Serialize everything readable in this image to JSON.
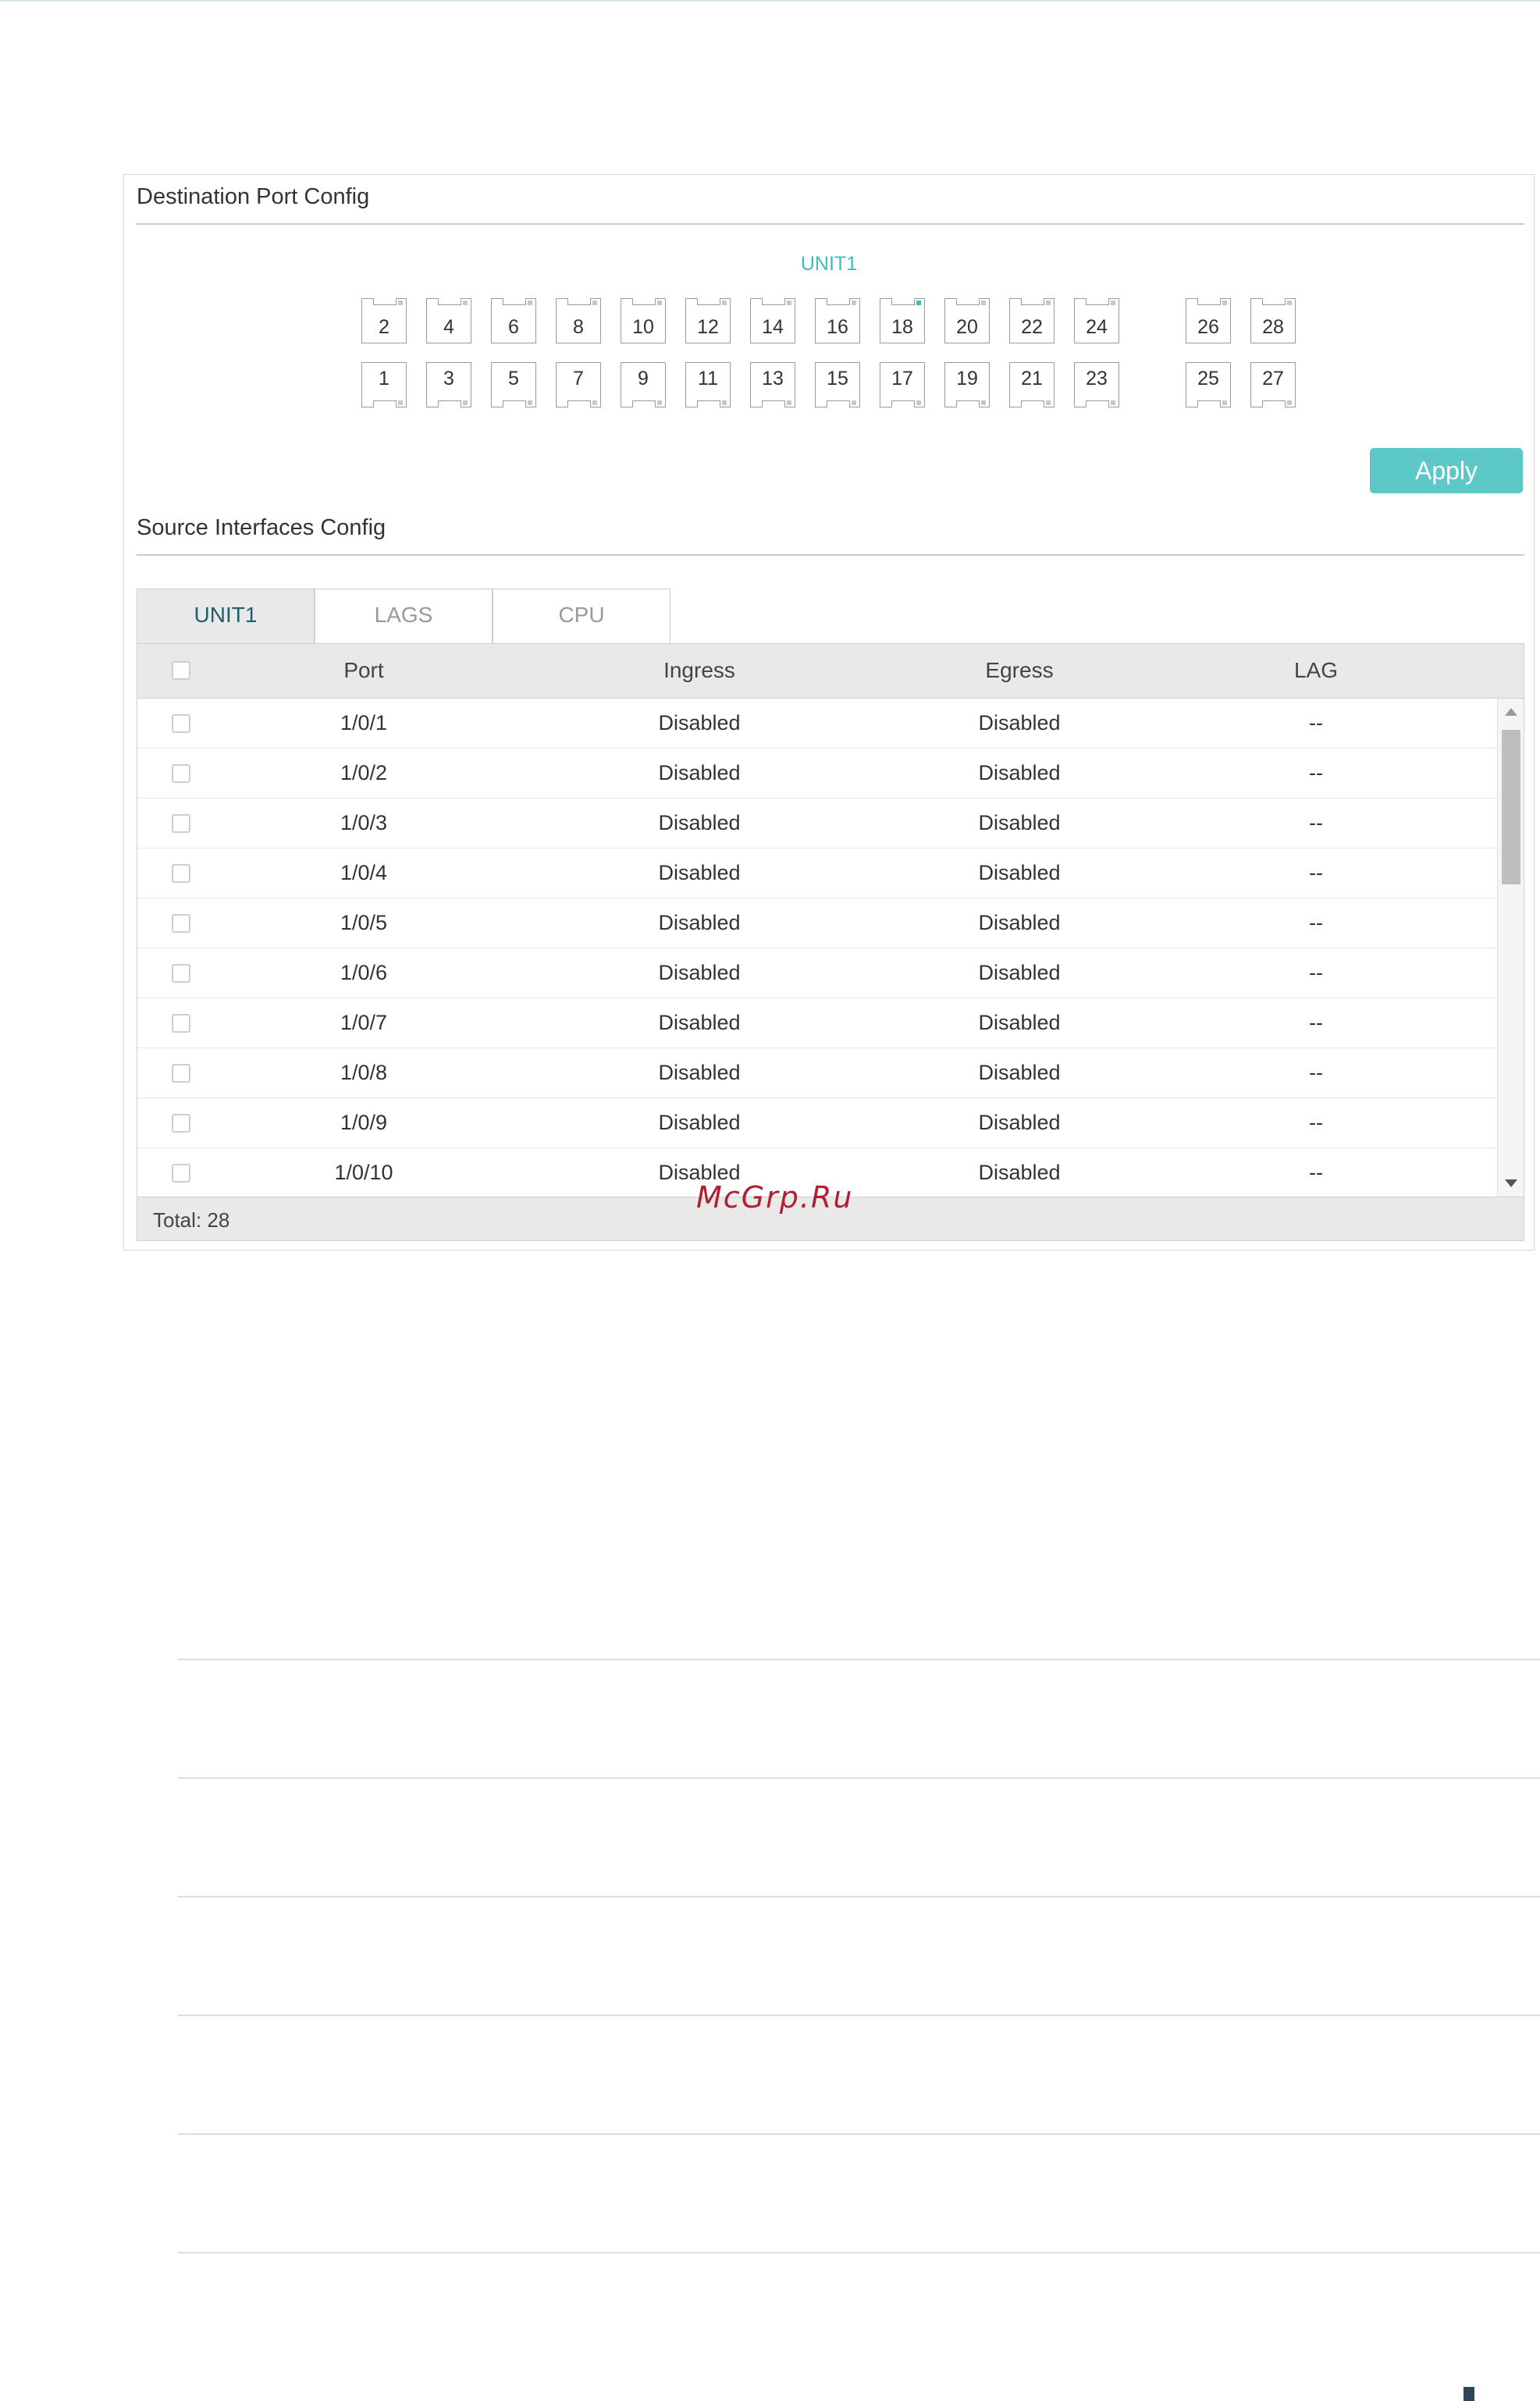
{
  "destination": {
    "title": "Destination Port Config",
    "unit_label": "UNIT1",
    "ports_top": [
      "2",
      "4",
      "6",
      "8",
      "10",
      "12",
      "14",
      "16",
      "18",
      "20",
      "22",
      "24",
      "26",
      "28"
    ],
    "ports_bottom": [
      "1",
      "3",
      "5",
      "7",
      "9",
      "11",
      "13",
      "15",
      "17",
      "19",
      "21",
      "23",
      "25",
      "27"
    ],
    "active_port": "18",
    "apply_label": "Apply",
    "accent_color": "#3fbdbd"
  },
  "source": {
    "title": "Source Interfaces Config",
    "tabs": [
      {
        "label": "UNIT1",
        "active": true
      },
      {
        "label": "LAGS",
        "active": false
      },
      {
        "label": "CPU",
        "active": false
      }
    ],
    "columns": [
      "Port",
      "Ingress",
      "Egress",
      "LAG"
    ],
    "rows": [
      {
        "port": "1/0/1",
        "ingress": "Disabled",
        "egress": "Disabled",
        "lag": "--"
      },
      {
        "port": "1/0/2",
        "ingress": "Disabled",
        "egress": "Disabled",
        "lag": "--"
      },
      {
        "port": "1/0/3",
        "ingress": "Disabled",
        "egress": "Disabled",
        "lag": "--"
      },
      {
        "port": "1/0/4",
        "ingress": "Disabled",
        "egress": "Disabled",
        "lag": "--"
      },
      {
        "port": "1/0/5",
        "ingress": "Disabled",
        "egress": "Disabled",
        "lag": "--"
      },
      {
        "port": "1/0/6",
        "ingress": "Disabled",
        "egress": "Disabled",
        "lag": "--"
      },
      {
        "port": "1/0/7",
        "ingress": "Disabled",
        "egress": "Disabled",
        "lag": "--"
      },
      {
        "port": "1/0/8",
        "ingress": "Disabled",
        "egress": "Disabled",
        "lag": "--"
      },
      {
        "port": "1/0/9",
        "ingress": "Disabled",
        "egress": "Disabled",
        "lag": "--"
      },
      {
        "port": "1/0/10",
        "ingress": "Disabled",
        "egress": "Disabled",
        "lag": "--"
      }
    ],
    "total_label": "Total: 28"
  },
  "watermark": "McGrp.Ru"
}
